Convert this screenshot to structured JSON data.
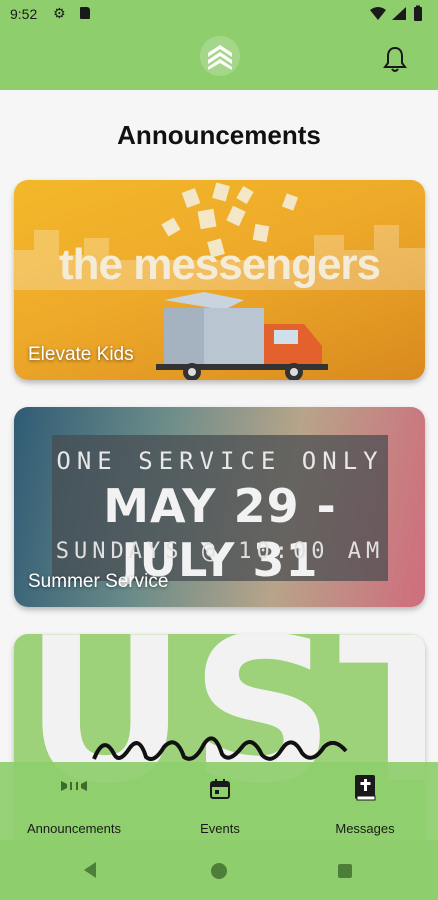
{
  "status_bar": {
    "time": "9:52",
    "icons": [
      "gear-icon",
      "sd-card-icon",
      "wifi-icon",
      "signal-icon",
      "battery-icon"
    ]
  },
  "header": {
    "logo_icon": "chevrons-up-logo",
    "notification_icon": "bell-icon",
    "background": "#8fce6d"
  },
  "page": {
    "title": "Announcements"
  },
  "cards": [
    {
      "label": "Elevate Kids",
      "art_text": "the messengers"
    },
    {
      "label": "Summer Service",
      "art_line1": "ONE SERVICE ONLY",
      "art_line2": "MAY 29 - JULY 31",
      "art_line3": "SUNDAYS @ 10:00 AM"
    },
    {
      "label": "",
      "art_text": "UST"
    }
  ],
  "bottom_nav": {
    "items": [
      {
        "label": "Announcements",
        "icon": "megaphone-icon",
        "active": true
      },
      {
        "label": "Events",
        "icon": "calendar-icon",
        "active": false
      },
      {
        "label": "Messages",
        "icon": "bible-icon",
        "active": false
      }
    ]
  },
  "system_nav": {
    "icons": [
      "back-icon",
      "home-icon",
      "recents-icon"
    ]
  },
  "colors": {
    "accent": "#8fce6d",
    "accent_dark": "#4e7f38"
  }
}
